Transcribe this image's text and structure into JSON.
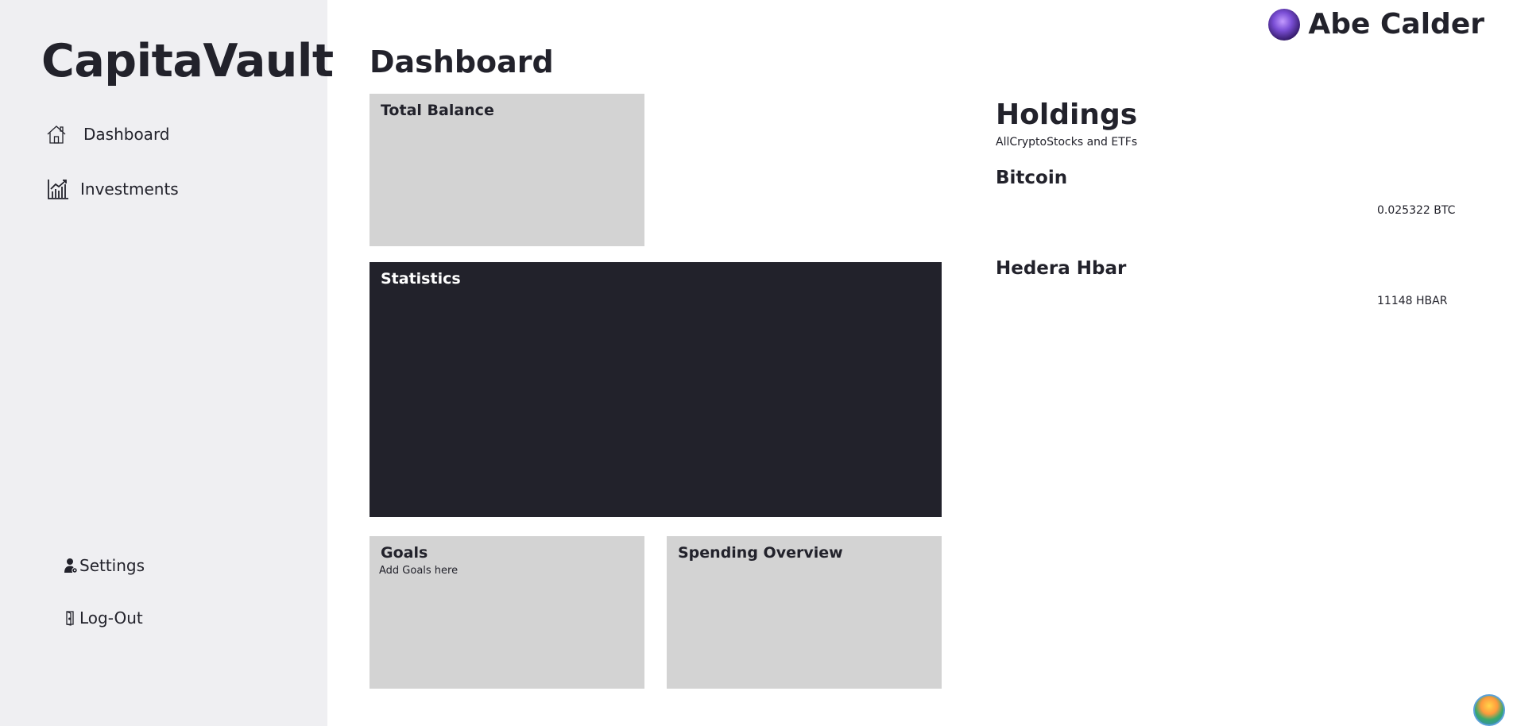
{
  "app": {
    "brand": "CapitaVault"
  },
  "sidebar": {
    "nav": [
      {
        "label": "Dashboard",
        "icon": "home-icon"
      },
      {
        "label": "Investments",
        "icon": "chart-icon"
      }
    ],
    "bottom": [
      {
        "label": "Settings",
        "icon": "user-settings-icon"
      },
      {
        "label": "Log-Out",
        "icon": "logout-icon"
      }
    ]
  },
  "header": {
    "user_name": "Abe Calder"
  },
  "main": {
    "title": "Dashboard",
    "cards": {
      "total_balance": {
        "title": "Total Balance"
      },
      "statistics": {
        "title": "Statistics"
      },
      "goals": {
        "title": "Goals",
        "subtitle": "Add Goals here"
      },
      "spending": {
        "title": "Spending Overview"
      }
    }
  },
  "holdings": {
    "title": "Holdings",
    "subtitle": "AllCryptoStocks and ETFs",
    "items": [
      {
        "name": "Bitcoin",
        "amount": "0.025322 BTC"
      },
      {
        "name": "Hedera Hbar",
        "amount": "11148 HBAR"
      }
    ]
  },
  "colors": {
    "sidebar_bg": "#efeff2",
    "card_bg": "#d3d3d3",
    "stats_bg": "#22222b",
    "text": "#22222b"
  }
}
